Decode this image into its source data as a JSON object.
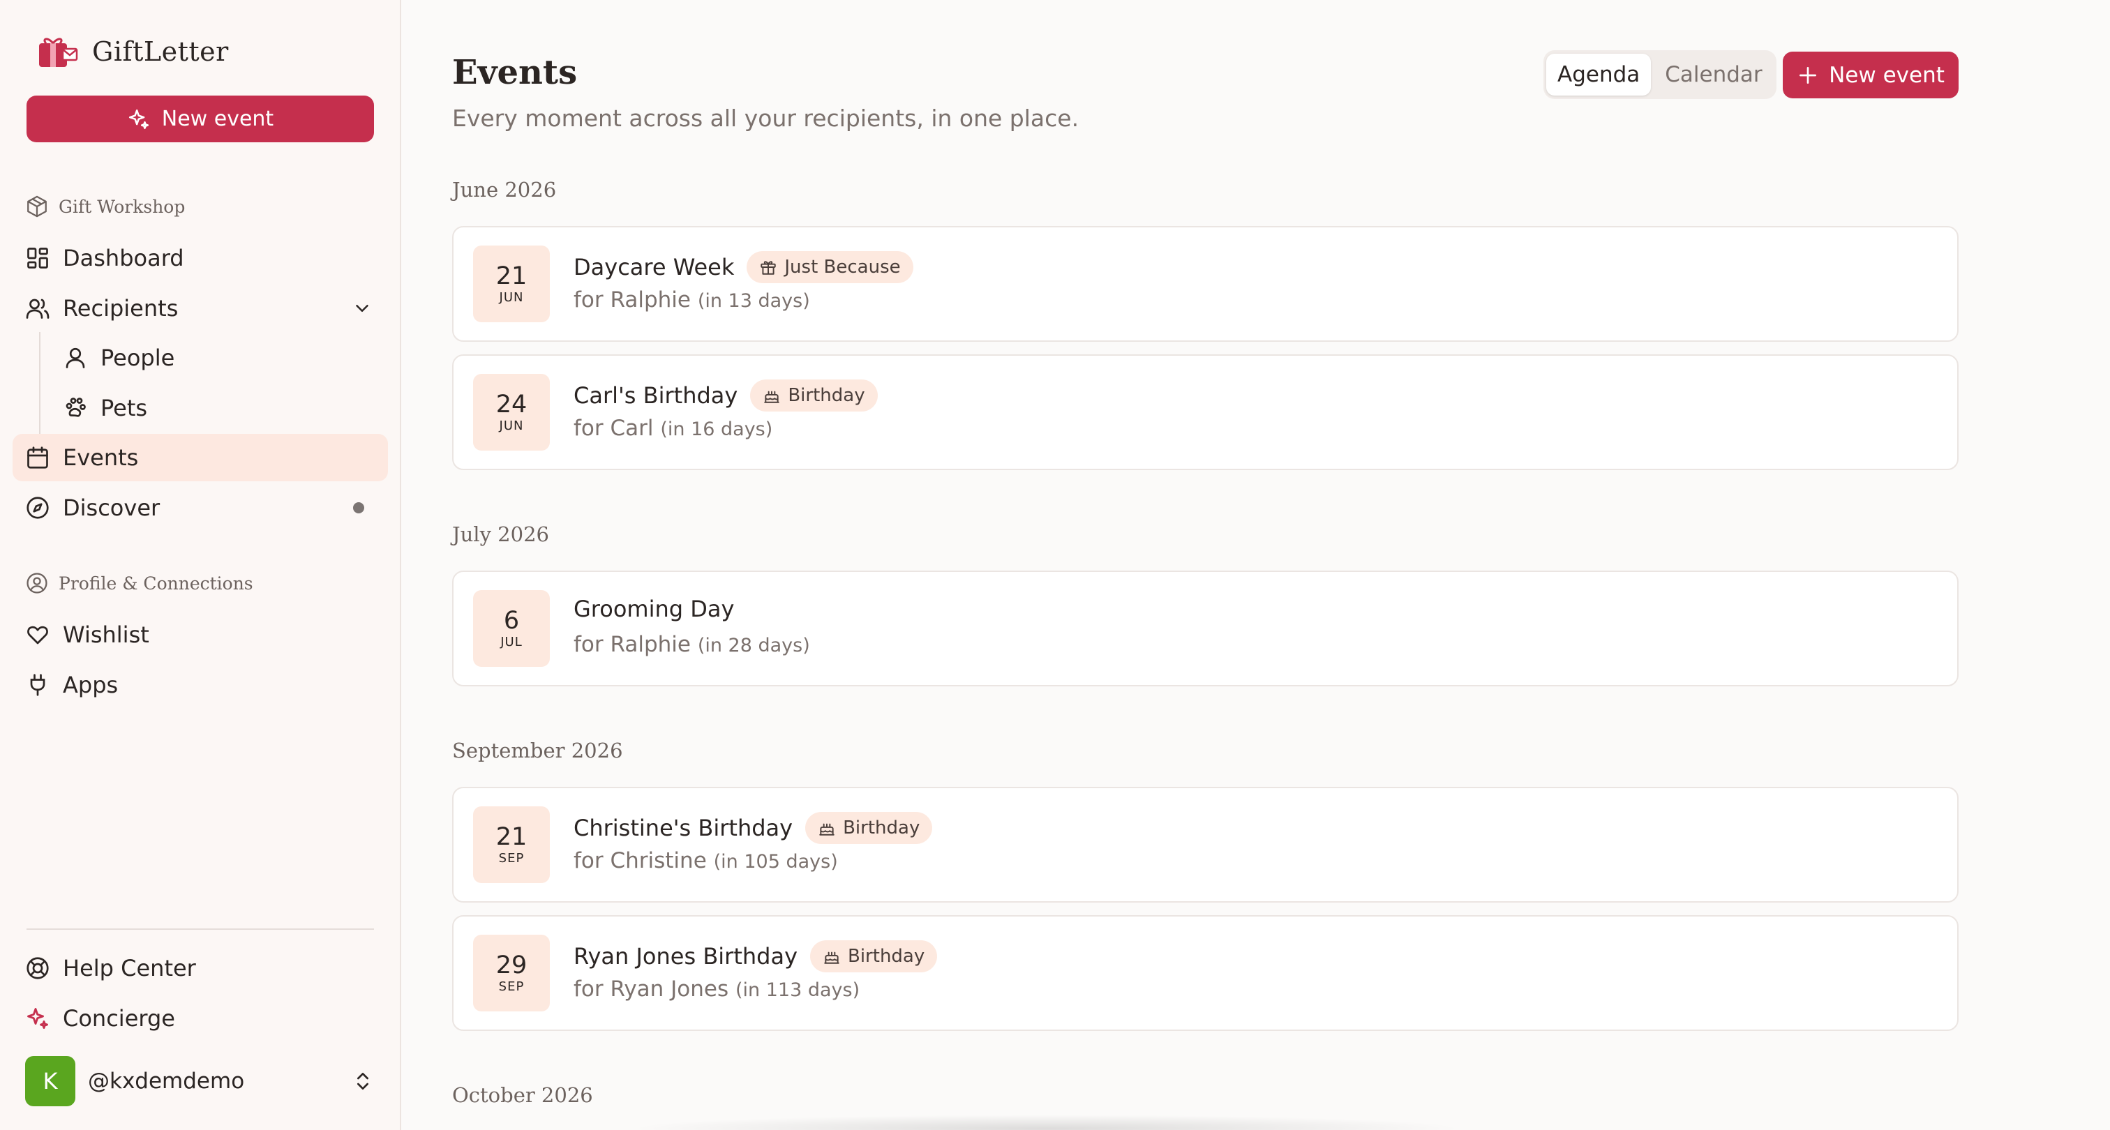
{
  "brand": {
    "name": "GiftLetter"
  },
  "sidebar": {
    "new_event_label": "New event",
    "section_gift_workshop": "Gift Workshop",
    "section_profile": "Profile & Connections",
    "items": [
      {
        "label": "Dashboard",
        "icon": "dashboard-icon"
      },
      {
        "label": "Recipients",
        "icon": "users-icon"
      },
      {
        "label": "People",
        "icon": "person-icon"
      },
      {
        "label": "Pets",
        "icon": "paw-icon"
      },
      {
        "label": "Events",
        "icon": "calendar-icon"
      },
      {
        "label": "Discover",
        "icon": "compass-icon"
      },
      {
        "label": "Wishlist",
        "icon": "heart-icon"
      },
      {
        "label": "Apps",
        "icon": "plug-icon"
      },
      {
        "label": "Help Center",
        "icon": "lifebuoy-icon"
      },
      {
        "label": "Concierge",
        "icon": "sparkles-icon"
      }
    ],
    "user": {
      "initial": "K",
      "handle": "@kxdemdemo"
    }
  },
  "header": {
    "title": "Events",
    "subtitle": "Every moment across all your recipients, in one place.",
    "view_tabs": [
      "Agenda",
      "Calendar"
    ],
    "active_view": "Agenda",
    "new_event_label": "New event"
  },
  "months": [
    {
      "label": "June 2026",
      "events": [
        {
          "day": "21",
          "mon": "JUN",
          "title": "Daycare Week",
          "tag": "Just Because",
          "for": "for Ralphie",
          "rel": "(in 13 days)"
        },
        {
          "day": "24",
          "mon": "JUN",
          "title": "Carl's Birthday",
          "tag": "Birthday",
          "for": "for Carl",
          "rel": "(in 16 days)"
        }
      ]
    },
    {
      "label": "July 2026",
      "events": [
        {
          "day": "6",
          "mon": "JUL",
          "title": "Grooming Day",
          "tag": "",
          "for": "for Ralphie",
          "rel": "(in 28 days)"
        }
      ]
    },
    {
      "label": "September 2026",
      "events": [
        {
          "day": "21",
          "mon": "SEP",
          "title": "Christine's Birthday",
          "tag": "Birthday",
          "for": "for Christine",
          "rel": "(in 105 days)"
        },
        {
          "day": "29",
          "mon": "SEP",
          "title": "Ryan Jones Birthday",
          "tag": "Birthday",
          "for": "for Ryan Jones",
          "rel": "(in 113 days)"
        }
      ]
    },
    {
      "label": "October 2026",
      "events": []
    }
  ],
  "colors": {
    "accent": "#c52f4d",
    "active_bg": "#fde8e0",
    "date_bg": "#fde9df",
    "avatar": "#5aa61f"
  }
}
